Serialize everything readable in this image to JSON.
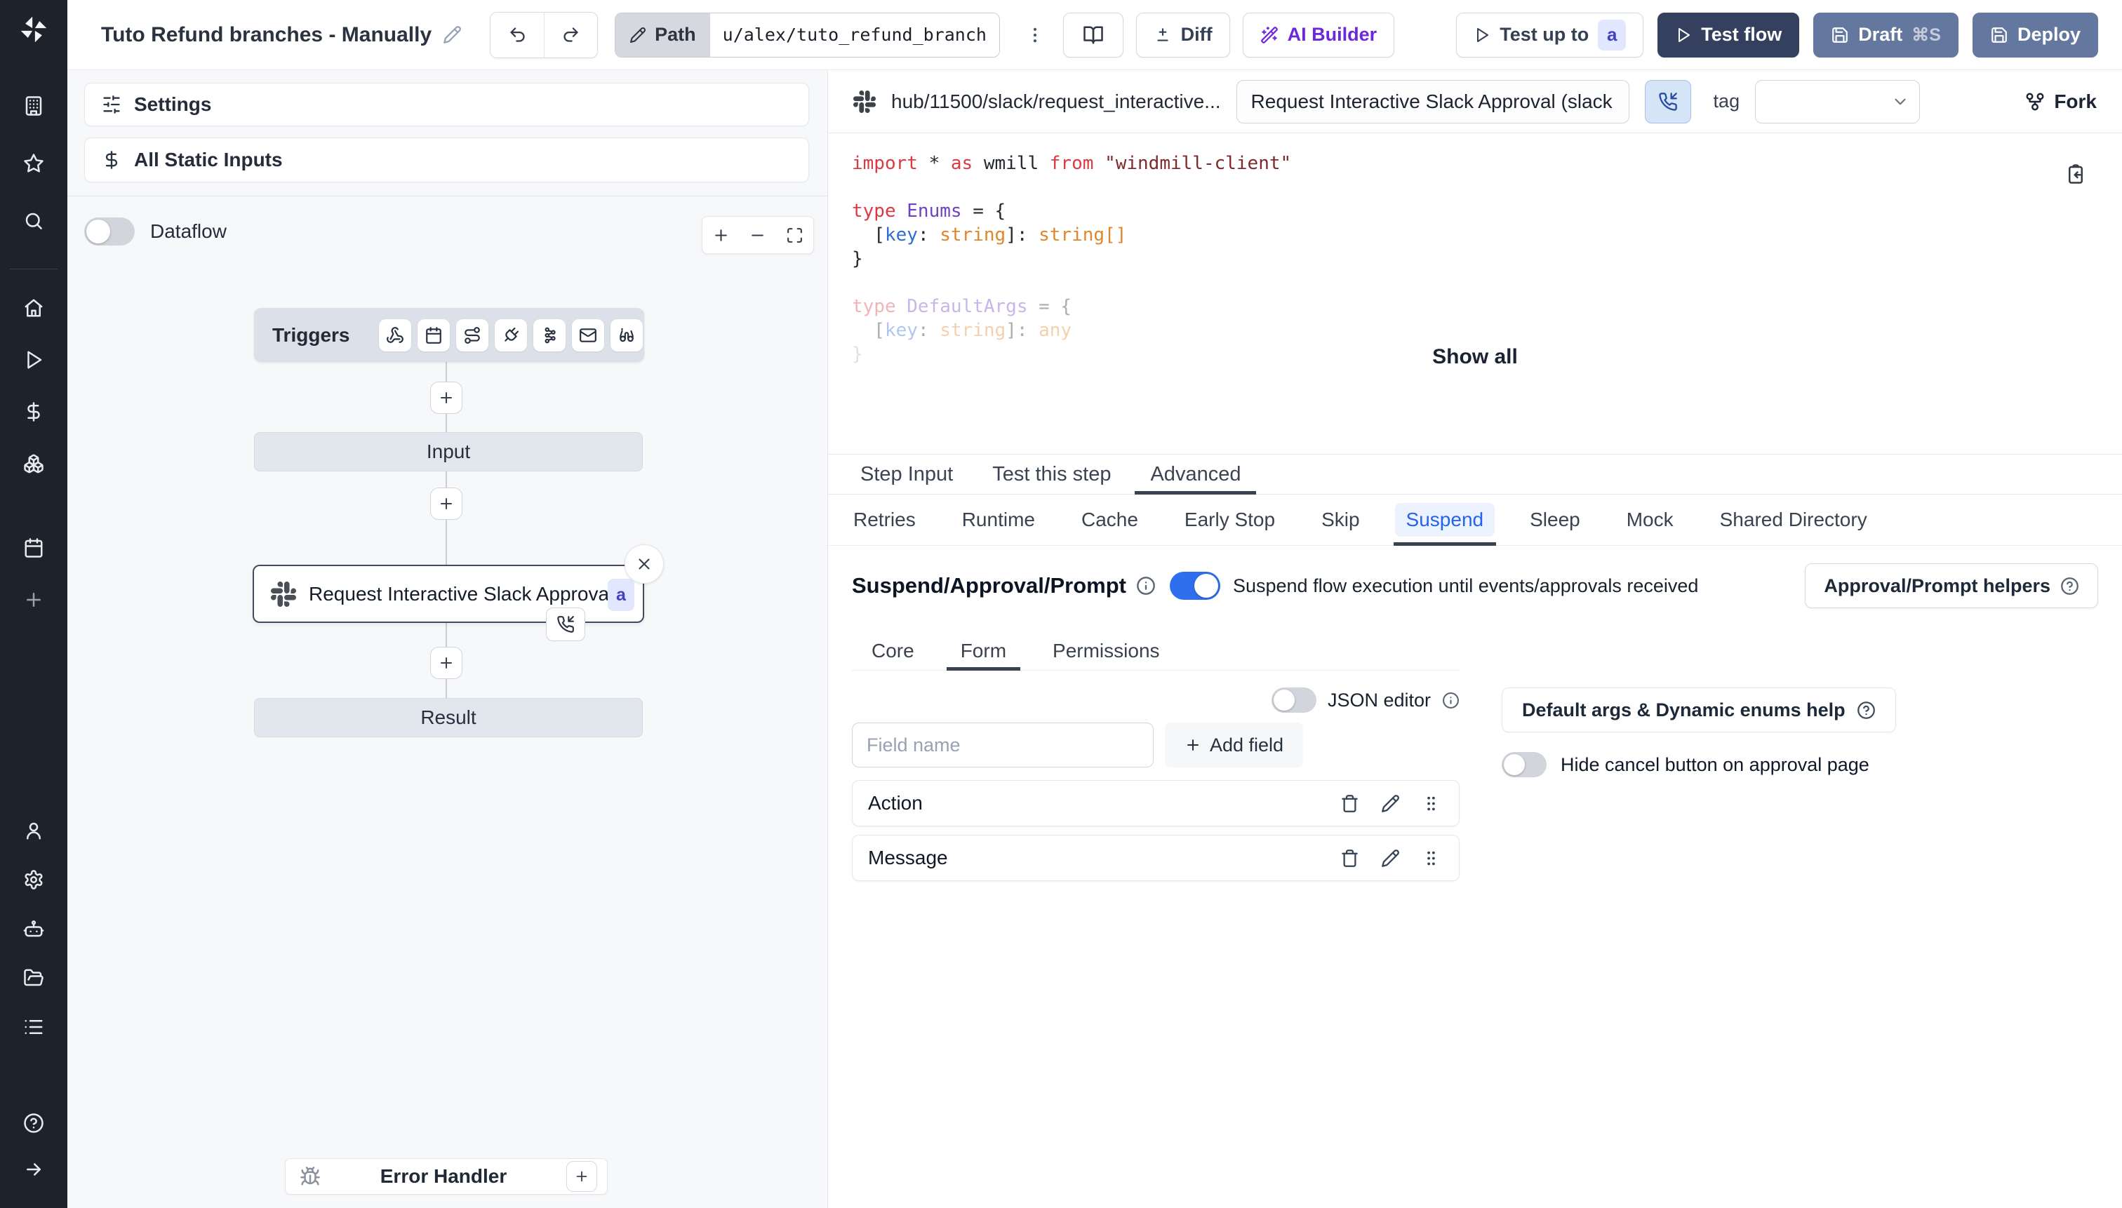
{
  "topbar": {
    "title": "Tuto Refund branches - Manually",
    "path_label": "Path",
    "path_value": "u/alex/tuto_refund_branches_",
    "diff_label": "Diff",
    "ai_builder_label": "AI Builder",
    "test_up_to_label": "Test up to",
    "test_badge": "a",
    "test_flow_label": "Test flow",
    "draft_label": "Draft",
    "draft_shortcut": "⌘S",
    "deploy_label": "Deploy"
  },
  "sidebar": {
    "icons_top": [
      "building",
      "star",
      "search"
    ],
    "icons_main": [
      "home",
      "play",
      "dollar",
      "boxes",
      "calendar",
      "plus"
    ],
    "icons_secondary": [
      "user",
      "gear",
      "robot",
      "folder",
      "list"
    ],
    "icons_bottom": [
      "help",
      "arrow-right"
    ]
  },
  "flow": {
    "settings_label": "Settings",
    "all_static_inputs_label": "All Static Inputs",
    "dataflow_label": "Dataflow",
    "triggers_label": "Triggers",
    "trigger_icons": [
      "webhook",
      "calendar",
      "route",
      "plug",
      "kafka",
      "mail",
      "watch"
    ],
    "input_label": "Input",
    "step_label": "Request Interactive Slack Approval (...",
    "step_badge": "a",
    "result_label": "Result",
    "error_handler_label": "Error Handler"
  },
  "editor": {
    "hub_path": "hub/11500/slack/request_interactive...",
    "summary": "Request Interactive Slack Approval (slack",
    "tag_label": "tag",
    "fork_label": "Fork",
    "show_all_label": "Show all",
    "code_lines": [
      {
        "tokens": [
          [
            "kw",
            "import"
          ],
          [
            "pl",
            " * "
          ],
          [
            "kw",
            "as"
          ],
          [
            "pl",
            " wmill "
          ],
          [
            "kw",
            "from"
          ],
          [
            "pl",
            " "
          ],
          [
            "str",
            "\"windmill-client\""
          ]
        ]
      },
      {
        "tokens": []
      },
      {
        "tokens": [
          [
            "kw",
            "type"
          ],
          [
            "pl",
            " "
          ],
          [
            "ty",
            "Enums"
          ],
          [
            "pl",
            " = {"
          ]
        ]
      },
      {
        "tokens": [
          [
            "pl",
            "  ["
          ],
          [
            "key",
            "key"
          ],
          [
            "pl",
            ": "
          ],
          [
            "ts",
            "string"
          ],
          [
            "pl",
            "]: "
          ],
          [
            "ts",
            "string[]"
          ]
        ]
      },
      {
        "tokens": [
          [
            "pl",
            "}"
          ]
        ]
      },
      {
        "tokens": []
      },
      {
        "dim": 1,
        "tokens": [
          [
            "kw",
            "type"
          ],
          [
            "pl",
            " "
          ],
          [
            "ty",
            "DefaultArgs"
          ],
          [
            "pl",
            " = {"
          ]
        ]
      },
      {
        "dim": 1,
        "tokens": [
          [
            "pl",
            "  ["
          ],
          [
            "key",
            "key"
          ],
          [
            "pl",
            ": "
          ],
          [
            "ts",
            "string"
          ],
          [
            "pl",
            "]: "
          ],
          [
            "ts",
            "any"
          ]
        ]
      },
      {
        "dim": 2,
        "tokens": [
          [
            "pl",
            "}"
          ]
        ]
      }
    ]
  },
  "tabs": {
    "main": [
      {
        "label": "Step Input"
      },
      {
        "label": "Test this step"
      },
      {
        "label": "Advanced",
        "active": true
      }
    ],
    "advanced": [
      {
        "label": "Retries"
      },
      {
        "label": "Runtime"
      },
      {
        "label": "Cache"
      },
      {
        "label": "Early Stop"
      },
      {
        "label": "Skip"
      },
      {
        "label": "Suspend",
        "active": true
      },
      {
        "label": "Sleep"
      },
      {
        "label": "Mock"
      },
      {
        "label": "Shared Directory"
      }
    ]
  },
  "suspend": {
    "heading": "Suspend/Approval/Prompt",
    "toggle_label": "Suspend flow execution until events/approvals received",
    "helpers_button_label": "Approval/Prompt helpers",
    "tabs": [
      {
        "label": "Core"
      },
      {
        "label": "Form",
        "active": true
      },
      {
        "label": "Permissions"
      }
    ],
    "json_editor_label": "JSON editor",
    "field_name_placeholder": "Field name",
    "add_field_label": "Add field",
    "fields": [
      {
        "name": "Action"
      },
      {
        "name": "Message"
      }
    ],
    "default_args_help_label": "Default args & Dynamic enums help",
    "hide_cancel_label": "Hide cancel button on approval page"
  },
  "colors": {
    "accent_blue": "#2f6fed",
    "navy": "#35405f",
    "slate_blue": "#64789f",
    "ai_purple": "#6d28d9",
    "badge_bg": "#e0e7ff",
    "badge_text": "#4340c4",
    "suspend_tab_blue": "#2563eb"
  }
}
